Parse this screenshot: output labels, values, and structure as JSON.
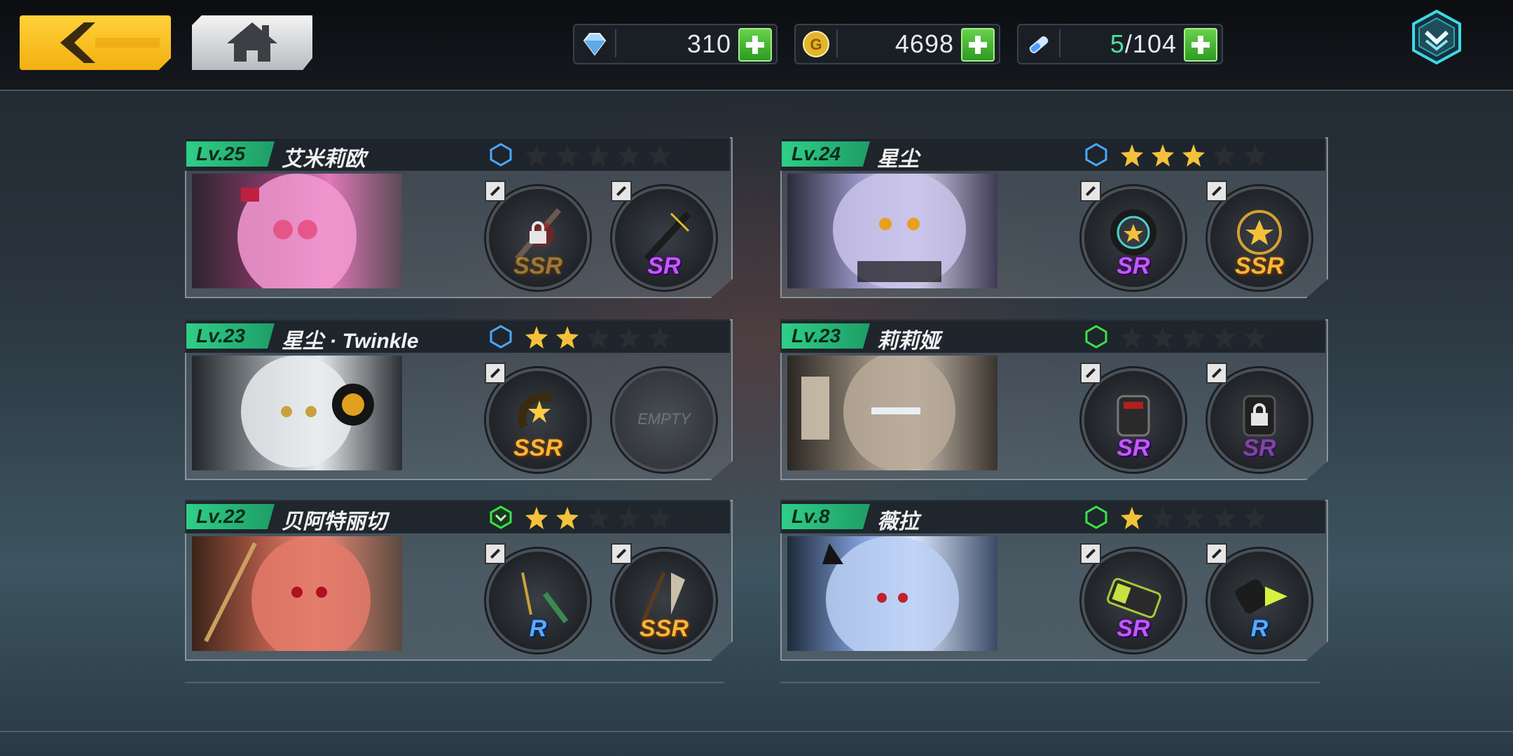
{
  "header": {
    "back_icon": "chevron-left-icon",
    "home_icon": "home-icon",
    "menu_icon": "chevron-down-shield-icon",
    "resources": [
      {
        "icon": "diamond-icon",
        "value": "310"
      },
      {
        "icon": "gold-coin-icon",
        "value": "4698"
      },
      {
        "icon": "stamina-tube-icon",
        "value_current": "5",
        "value_max": "/104"
      }
    ]
  },
  "colors": {
    "accent_green": "#2fcf87",
    "back_yellow": "#f2b010",
    "ssr": "#f8b53a",
    "sr": "#c458ff",
    "r": "#5aa8ff"
  },
  "characters": [
    {
      "level": "Lv.25",
      "name": "艾米莉欧",
      "hex": "blue",
      "stars": 0,
      "slots": [
        {
          "rarity": "SSR",
          "locked": true
        },
        {
          "rarity": "SR",
          "locked": false
        }
      ]
    },
    {
      "level": "Lv.24",
      "name": "星尘",
      "hex": "blue",
      "stars": 3,
      "slots": [
        {
          "rarity": "SR",
          "locked": false
        },
        {
          "rarity": "SSR",
          "locked": false
        }
      ]
    },
    {
      "level": "Lv.23",
      "name": "星尘 · Twinkle",
      "hex": "blue",
      "stars": 2,
      "slots": [
        {
          "rarity": "SSR",
          "locked": false
        },
        {
          "rarity": "EMPTY",
          "locked": false
        }
      ]
    },
    {
      "level": "Lv.23",
      "name": "莉莉娅",
      "hex": "green",
      "stars": 0,
      "slots": [
        {
          "rarity": "SR",
          "locked": false
        },
        {
          "rarity": "SR",
          "locked": true
        }
      ]
    },
    {
      "level": "Lv.22",
      "name": "贝阿特丽切",
      "hex": "green-chevron",
      "stars": 2,
      "slots": [
        {
          "rarity": "R",
          "locked": false
        },
        {
          "rarity": "SSR",
          "locked": false
        }
      ]
    },
    {
      "level": "Lv.8",
      "name": "薇拉",
      "hex": "green",
      "stars": 1,
      "slots": [
        {
          "rarity": "SR",
          "locked": false
        },
        {
          "rarity": "R",
          "locked": false
        }
      ]
    }
  ]
}
